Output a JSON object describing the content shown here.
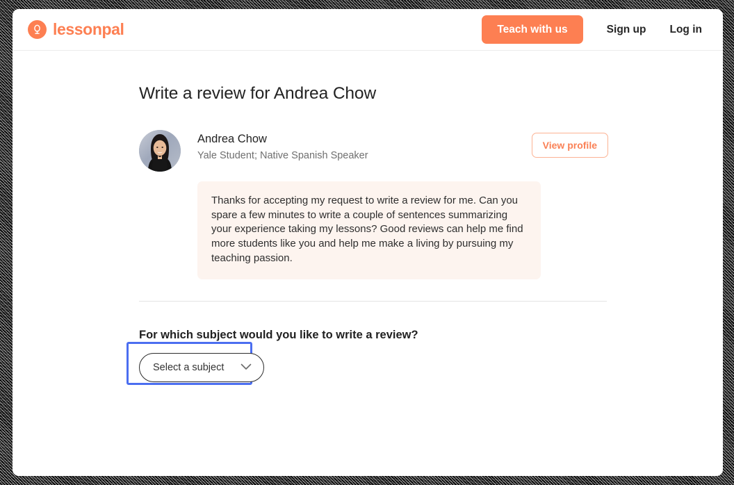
{
  "header": {
    "brand_name": "lessonpal",
    "brand_icon": "lessonpal-logo-icon",
    "teach_button": "Teach with us",
    "signup_link": "Sign up",
    "login_link": "Log in"
  },
  "main": {
    "page_title": "Write a review for Andrea Chow",
    "tutor": {
      "avatar_alt": "Andrea Chow profile photo",
      "name": "Andrea Chow",
      "tagline": "Yale Student; Native Spanish Speaker",
      "view_profile_button": "View profile",
      "message": "Thanks for accepting my request to write a review for me. Can you spare a few minutes to write a couple of sentences summarizing your experience taking my lessons? Good reviews can help me find more students like you and help me make a living by pursuing my teaching passion."
    },
    "subject": {
      "question": "For which subject would you like to write a review?",
      "select_value": "Select a subject",
      "select_icon": "chevron-down-icon"
    }
  },
  "colors": {
    "brand_orange": "#fd7f52",
    "message_bg": "#fdf4ef",
    "annotation_blue": "#4b6ef0",
    "text_primary": "#232323",
    "text_muted": "#6f6f6f"
  }
}
